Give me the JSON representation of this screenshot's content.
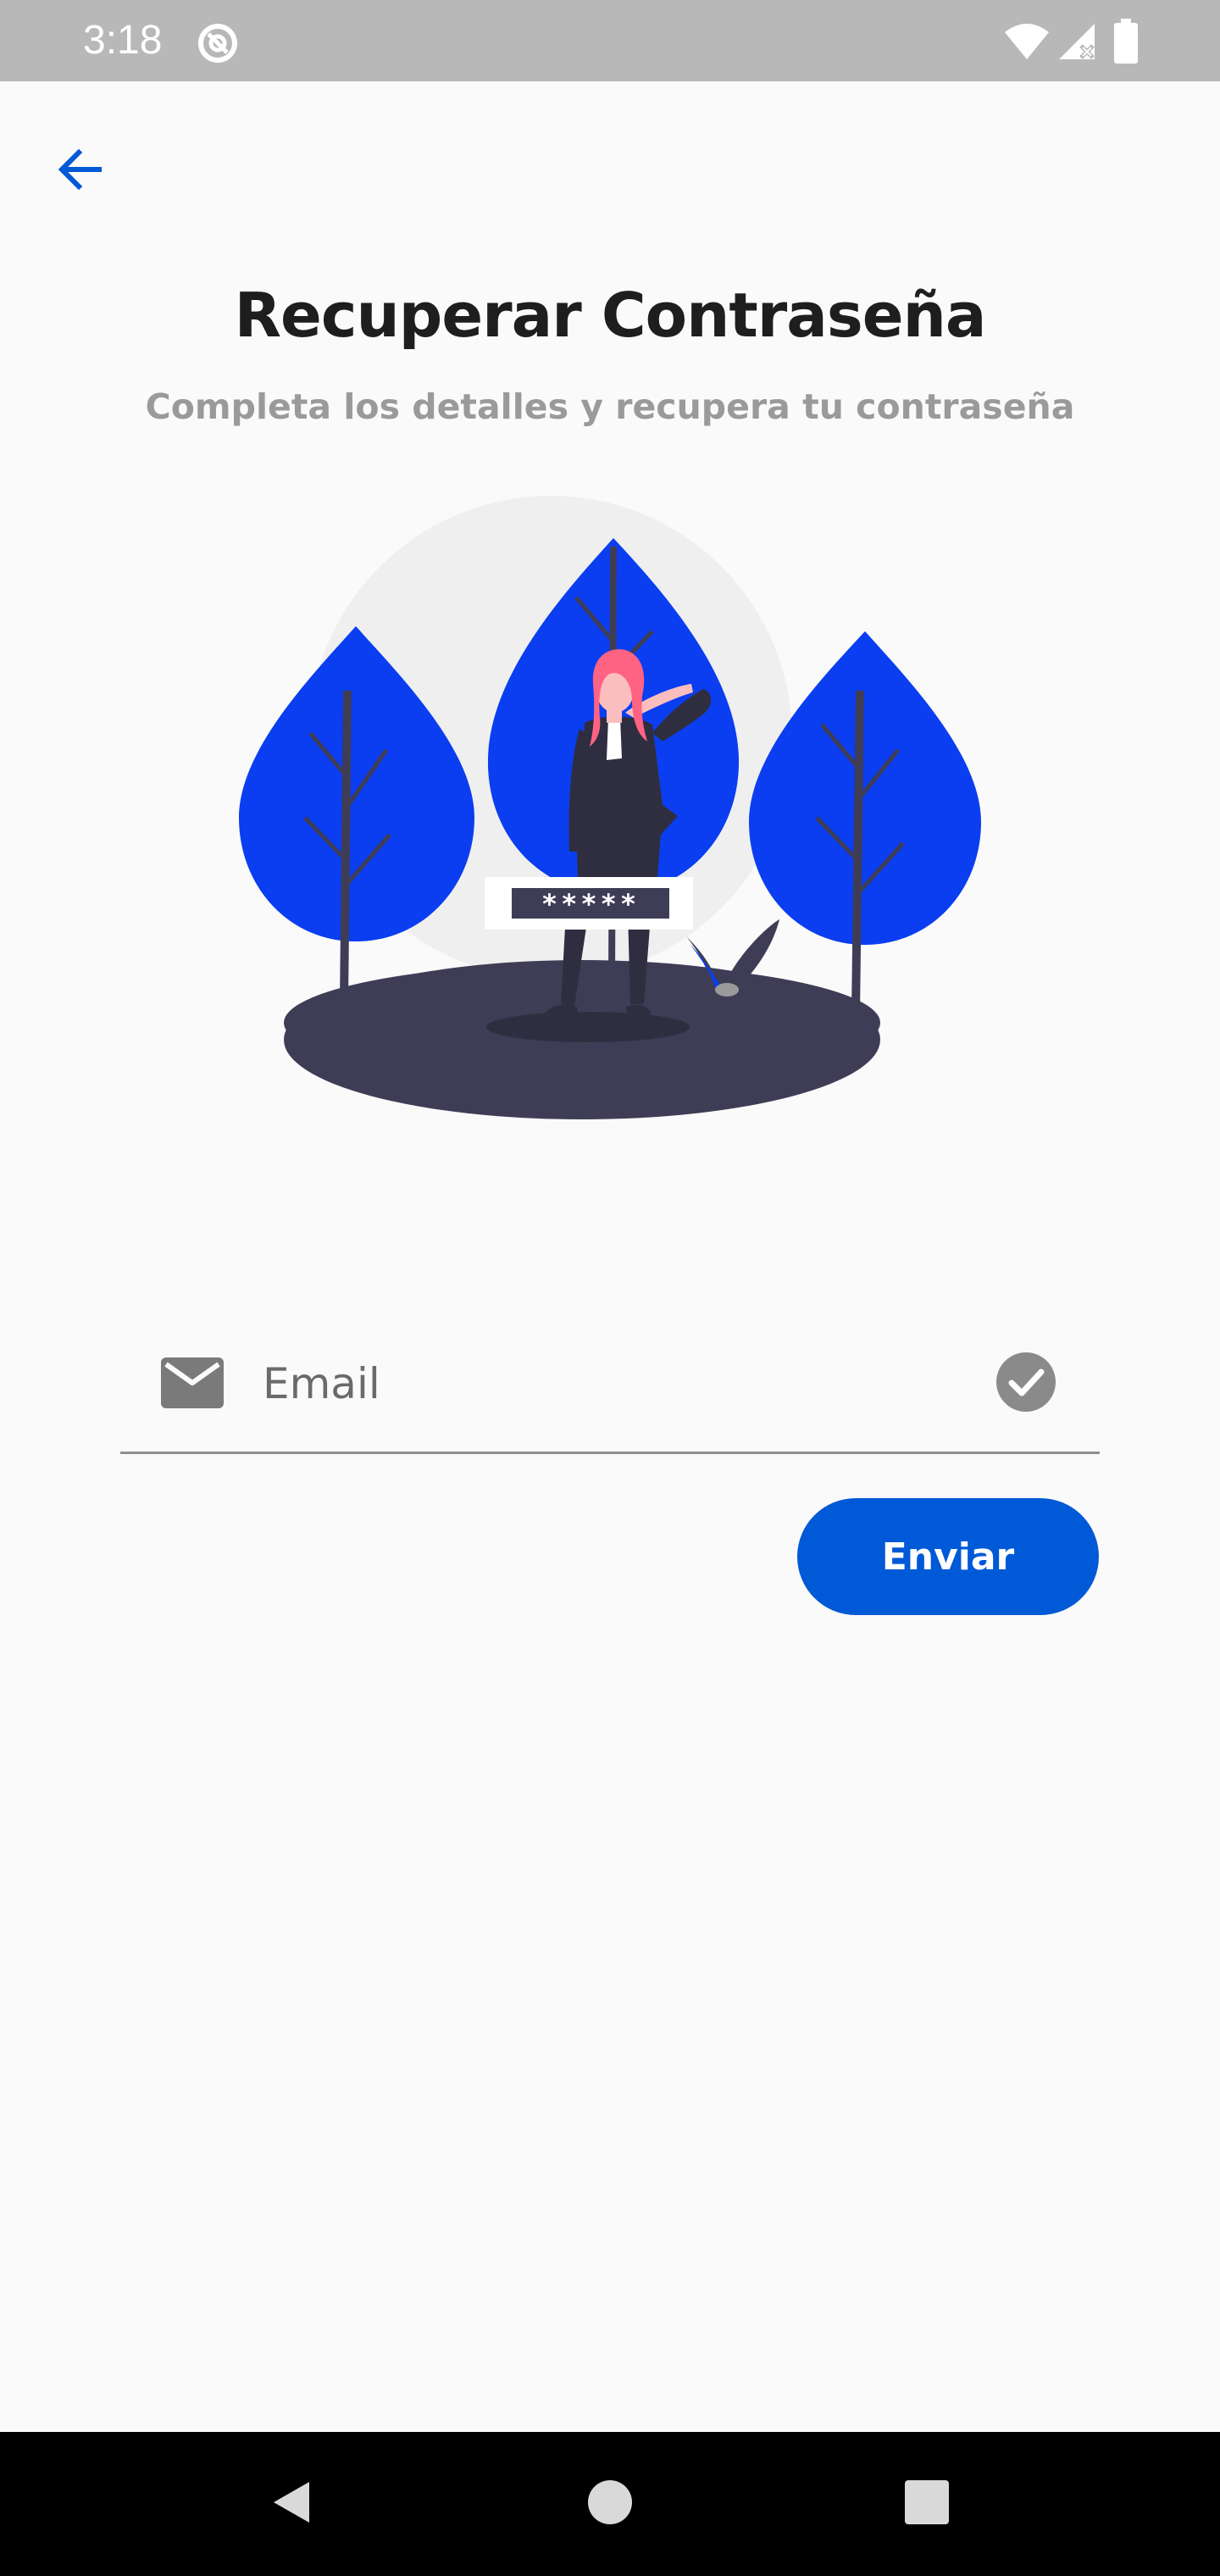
{
  "status_bar": {
    "time": "3:18",
    "icons": [
      "at-sign-icon",
      "wifi-icon",
      "signal-icon",
      "battery-icon"
    ]
  },
  "header": {
    "back_icon": "arrow-left-icon"
  },
  "page": {
    "title": "Recuperar Contraseña",
    "subtitle": "Completa los detalles y recupera tu contraseña"
  },
  "illustration": {
    "password_mask": "*****"
  },
  "form": {
    "email": {
      "placeholder": "Email",
      "value": "",
      "leading_icon": "mail-icon",
      "trailing_icon": "check-circle-icon"
    },
    "submit_label": "Enviar"
  },
  "nav_bar": {
    "buttons": [
      "back-triangle-icon",
      "home-circle-icon",
      "recents-square-icon"
    ]
  },
  "colors": {
    "accent": "#0059D6",
    "illustration_blue": "#0A3EF0",
    "dark_figure": "#3F3D56",
    "title_text": "#1E1E1E",
    "subtitle_text": "#9A9A9A",
    "status_bar": "#B8B8B8",
    "background": "#FAFAFA"
  }
}
